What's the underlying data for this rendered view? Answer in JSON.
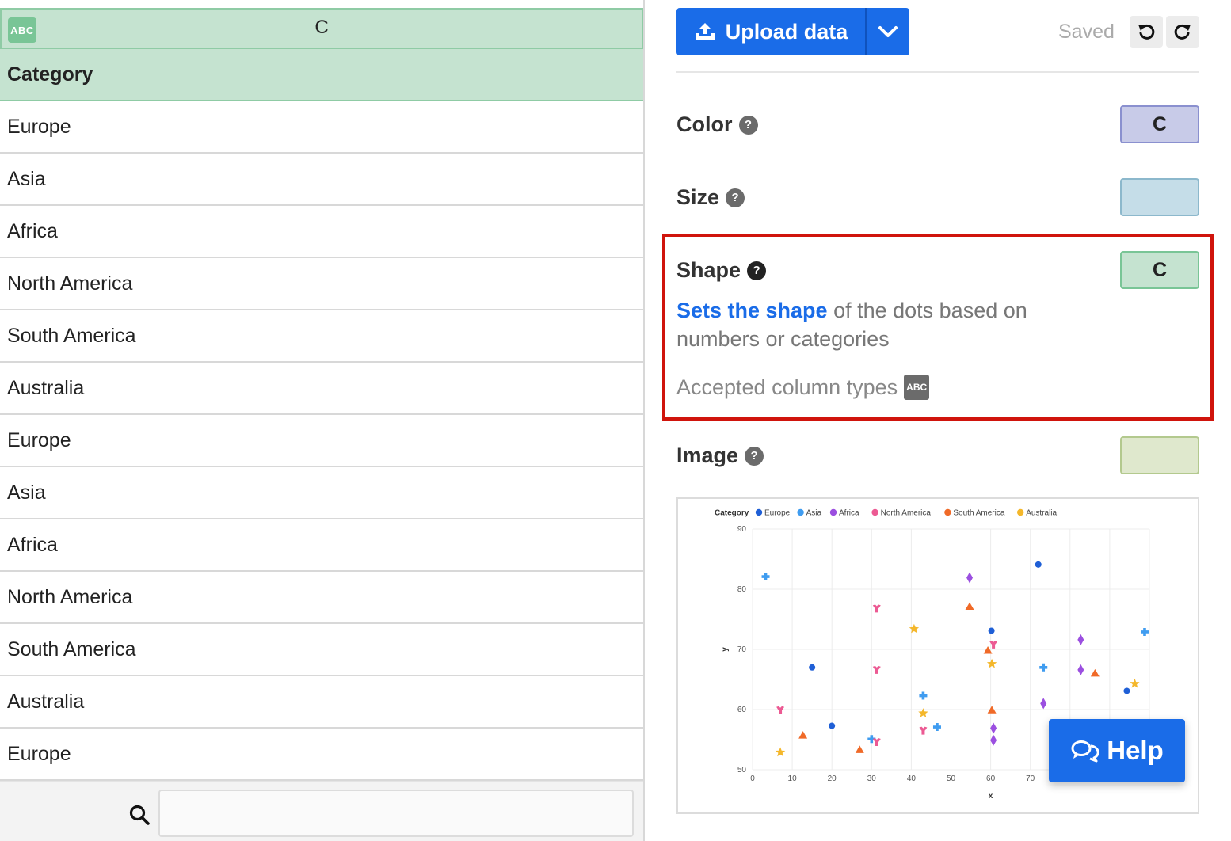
{
  "grid": {
    "column_letter": "C",
    "column_type_badge": "ABC",
    "header": "Category",
    "rows": [
      "Europe",
      "Asia",
      "Africa",
      "North America",
      "South America",
      "Australia",
      "Europe",
      "Asia",
      "Africa",
      "North America",
      "South America",
      "Australia",
      "Europe"
    ],
    "search_value": ""
  },
  "toolbar": {
    "upload_label": "Upload data",
    "saved_label": "Saved"
  },
  "bindings": {
    "color": {
      "label": "Color",
      "help": "?",
      "value": "C"
    },
    "size": {
      "label": "Size",
      "help": "?",
      "value": ""
    },
    "shape": {
      "label": "Shape",
      "help": "?",
      "value": "C",
      "description_link": "Sets the shape",
      "description_rest": " of the dots based on numbers or categories",
      "accepted_label": "Accepted column types",
      "accepted_badge": "ABC"
    },
    "image": {
      "label": "Image",
      "help": "?",
      "value": ""
    }
  },
  "help_button": {
    "label": "Help"
  },
  "colors": {
    "accent": "#1a6ce8",
    "highlight": "#d0140c",
    "text_column": "#c5e3d0",
    "numeric_column": "#c8cbe8"
  },
  "chart_data": {
    "type": "scatter",
    "legend_title": "Category",
    "legend_position": "top-left",
    "xlabel": "x",
    "ylabel": "y",
    "xlim": [
      0,
      100
    ],
    "ylim": [
      50,
      90
    ],
    "x_ticks": [
      0,
      10,
      20,
      30,
      40,
      50,
      60,
      70
    ],
    "y_ticks": [
      50,
      60,
      70,
      80,
      90
    ],
    "grid": true,
    "series": [
      {
        "name": "Europe",
        "color": "#1f5fd6",
        "shape": "circle",
        "points": [
          [
            15,
            67
          ],
          [
            20,
            57.3
          ],
          [
            60.2,
            73.1
          ],
          [
            72,
            84.1
          ],
          [
            94.3,
            63.1
          ]
        ]
      },
      {
        "name": "Asia",
        "color": "#3f9cf0",
        "shape": "cross",
        "points": [
          [
            3.3,
            82.1
          ],
          [
            30,
            55.1
          ],
          [
            43,
            62.3
          ],
          [
            46.5,
            57.1
          ],
          [
            73.3,
            67
          ],
          [
            98.8,
            72.9
          ]
        ]
      },
      {
        "name": "Africa",
        "color": "#9b4fe0",
        "shape": "diamond",
        "points": [
          [
            54.7,
            81.9
          ],
          [
            60.7,
            56.9
          ],
          [
            60.7,
            54.9
          ],
          [
            73.3,
            61
          ],
          [
            82.7,
            71.6
          ],
          [
            82.7,
            66.6
          ]
        ]
      },
      {
        "name": "North America",
        "color": "#ec5a93",
        "shape": "tshirt",
        "points": [
          [
            7,
            59.9
          ],
          [
            31.3,
            76.8
          ],
          [
            31.3,
            66.6
          ],
          [
            31.3,
            54.6
          ],
          [
            43,
            56.5
          ],
          [
            60.7,
            70.8
          ]
        ]
      },
      {
        "name": "South America",
        "color": "#f06a28",
        "shape": "triangle",
        "points": [
          [
            12.7,
            55.7
          ],
          [
            27,
            53.3
          ],
          [
            54.7,
            77.1
          ],
          [
            59.3,
            69.8
          ],
          [
            60.3,
            59.9
          ],
          [
            86.3,
            66
          ]
        ]
      },
      {
        "name": "Australia",
        "color": "#f4b72b",
        "shape": "star",
        "points": [
          [
            7,
            52.9
          ],
          [
            40.7,
            73.4
          ],
          [
            43,
            59.4
          ],
          [
            60.3,
            67.6
          ],
          [
            96.3,
            64.3
          ]
        ]
      }
    ]
  }
}
